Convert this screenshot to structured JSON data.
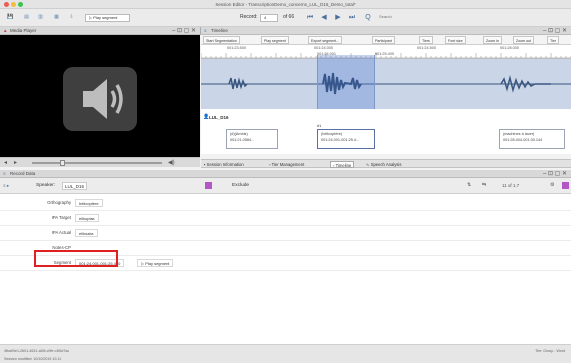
{
  "window": {
    "title": "Session Editor - TranscriptionDemo_concerns_LUL_D16_Demo_total*"
  },
  "toolbar": {
    "play_segment_label": "Play segment",
    "record_label": "Record:",
    "record_value": "4",
    "record_total": "of 66",
    "search_placeholder": "Search"
  },
  "media_player": {
    "title": "Media Player"
  },
  "timeline": {
    "title": "Timeline",
    "buttons": [
      "Start Segmentation",
      "Play segment",
      "Export segment...",
      "Participant",
      "Tiers",
      "Font size",
      "Zoom in",
      "Zoom out",
      "Tier"
    ],
    "ruler_ticks": [
      "001:23.500",
      "001:24.000",
      "001:24.500",
      "001:28.000",
      "001:24.001",
      "001:25.400"
    ],
    "tier_name": "LUL_D16",
    "segments": [
      {
        "word": "(#)(Ambis)",
        "time": "001:21.0584..."
      },
      {
        "word": "(hélicoptère)",
        "time": "001:24.001-001:25.4..."
      },
      {
        "word": "(machines à laver)",
        "time": "001:28.404-001:30.144"
      }
    ],
    "segment_marker": "#1"
  },
  "tabs": {
    "items": [
      "Session Information",
      "Tier Management",
      "Timeline",
      "Speech Analysis"
    ]
  },
  "record": {
    "title": "Record Data",
    "speaker_label": "Speaker:",
    "speaker_value": "LUL_D16",
    "exclude_label": "Exclude",
    "nav_text": "11 of 1.7",
    "rows": [
      {
        "label": "Orthography",
        "value": "hélicoptère"
      },
      {
        "label": "IPA Target",
        "value": "elikoptɛʁ"
      },
      {
        "label": "IPA Actual",
        "value": "elikoabɛ"
      },
      {
        "label": "Notes-CP",
        "value": ""
      },
      {
        "label": "Segment",
        "value": "001:24.001-001:25.400"
      }
    ],
    "segment_play_label": "Play segment"
  },
  "status": {
    "left": "4fba09e1-2601-4631-a5f4-c9fe c4f6d7ac",
    "right": "Tier: Group - Word",
    "bottom_left": "Session modified: 10/10/2019 10:11"
  }
}
